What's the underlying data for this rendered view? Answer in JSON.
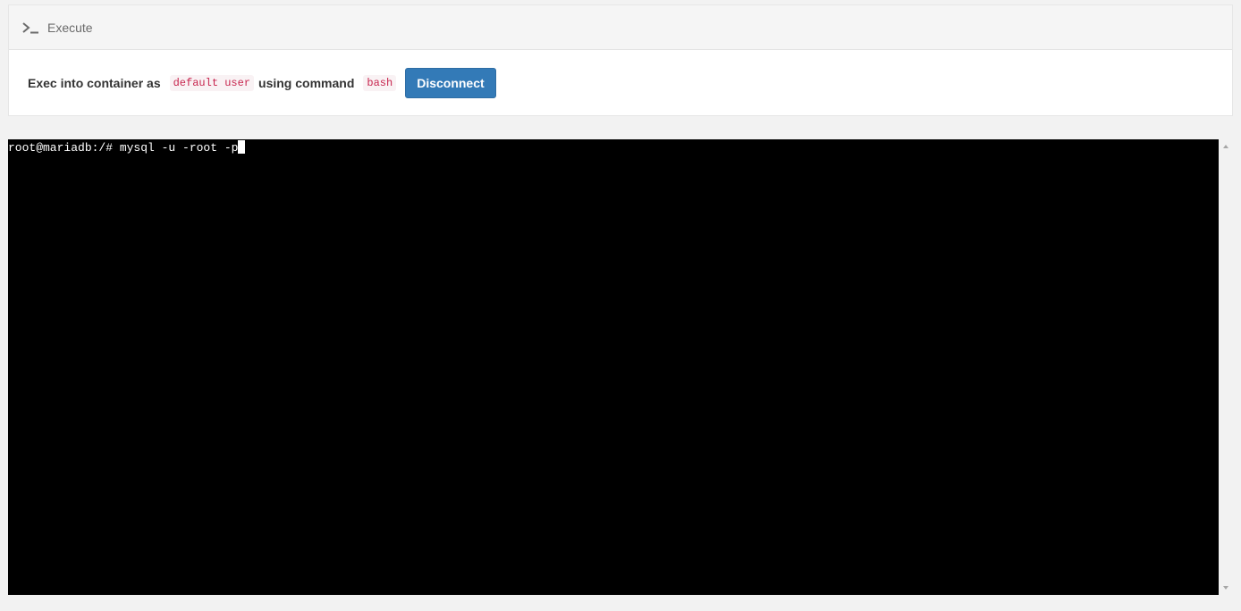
{
  "panel": {
    "title": "Execute",
    "icon": "terminal-icon"
  },
  "exec": {
    "prefix": "Exec into container as",
    "user": "default user",
    "middle": "using command",
    "command": "bash",
    "disconnect_label": "Disconnect"
  },
  "terminal": {
    "line": "root@mariadb:/# mysql -u -root -p"
  },
  "colors": {
    "button": "#337ab7",
    "code_text": "#c7254e",
    "code_bg": "#f9f2f4",
    "terminal_bg": "#000000",
    "terminal_text": "#ffffff"
  }
}
